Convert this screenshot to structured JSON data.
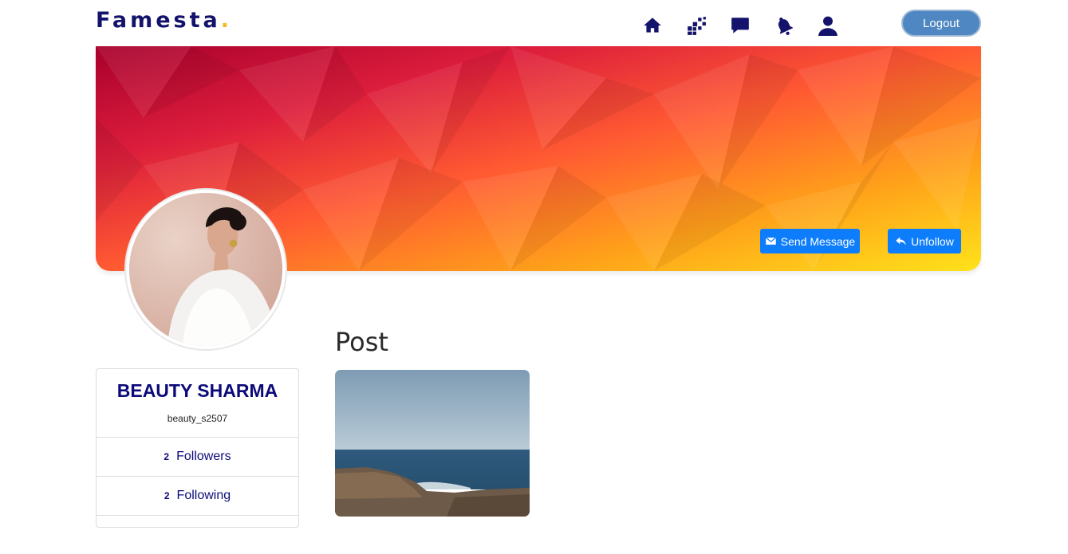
{
  "brand": {
    "name": "Famesta",
    "dot": ".",
    "color": "#14136b",
    "dot_color": "#f5b921"
  },
  "nav": {
    "icons": [
      "home-icon",
      "dashboard-icon",
      "chat-icon",
      "notification-bell-icon",
      "user-profile-icon"
    ],
    "logout_label": "Logout"
  },
  "cover": {
    "actions": {
      "message_label": "Send Message",
      "unfollow_label": "Unfollow"
    },
    "accent": "#0d7dfb"
  },
  "profile": {
    "name": "BEAUTY SHARMA",
    "username": "beauty_s2507",
    "followers": {
      "count": "2",
      "label": "Followers"
    },
    "following": {
      "count": "2",
      "label": "Following"
    }
  },
  "posts": {
    "heading": "Post"
  }
}
